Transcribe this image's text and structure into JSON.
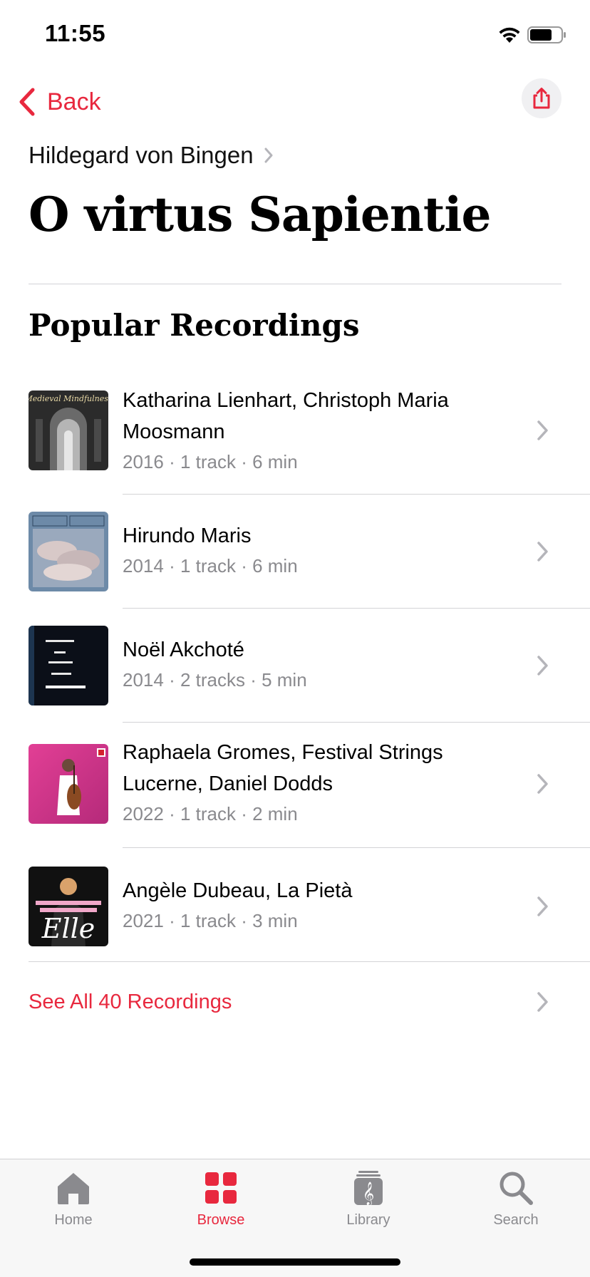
{
  "status_bar": {
    "time": "11:55"
  },
  "nav": {
    "back_label": "Back",
    "share_icon": "share-icon"
  },
  "header": {
    "composer": "Hildegard von Bingen",
    "title": "O virtus Sapientie"
  },
  "section": {
    "title": "Popular Recordings"
  },
  "recordings": [
    {
      "artist": "Katharina Lienhart, Christoph Maria Moosmann",
      "meta": "2016 · 1 track · 6 min",
      "artwork": "Medieval Mindfulness",
      "artwork_color": "#2b2b2b"
    },
    {
      "artist": "Hirundo Maris",
      "meta": "2014 · 1 track · 6 min",
      "artwork_color": "#6d8aa8"
    },
    {
      "artist": "Noël Akchoté",
      "meta": "2014 · 2 tracks · 5 min",
      "artwork_color": "#0b0f18"
    },
    {
      "artist": "Raphaela Gromes, Festival Strings Lucerne, Daniel Dodds",
      "meta": "2022 · 1 track · 2 min",
      "artwork_color": "#d23a8c"
    },
    {
      "artist": "Angèle Dubeau, La Pietà",
      "meta": "2021 · 1 track · 3 min",
      "artwork": "Elle",
      "artwork_color": "#111111"
    }
  ],
  "see_all": {
    "label": "See All 40 Recordings"
  },
  "tab_bar": {
    "home": "Home",
    "browse": "Browse",
    "library": "Library",
    "search": "Search",
    "active": "Browse"
  },
  "colors": {
    "accent": "#e8283e",
    "secondary_text": "#8a8a8e",
    "separator": "#d3d3d6"
  }
}
